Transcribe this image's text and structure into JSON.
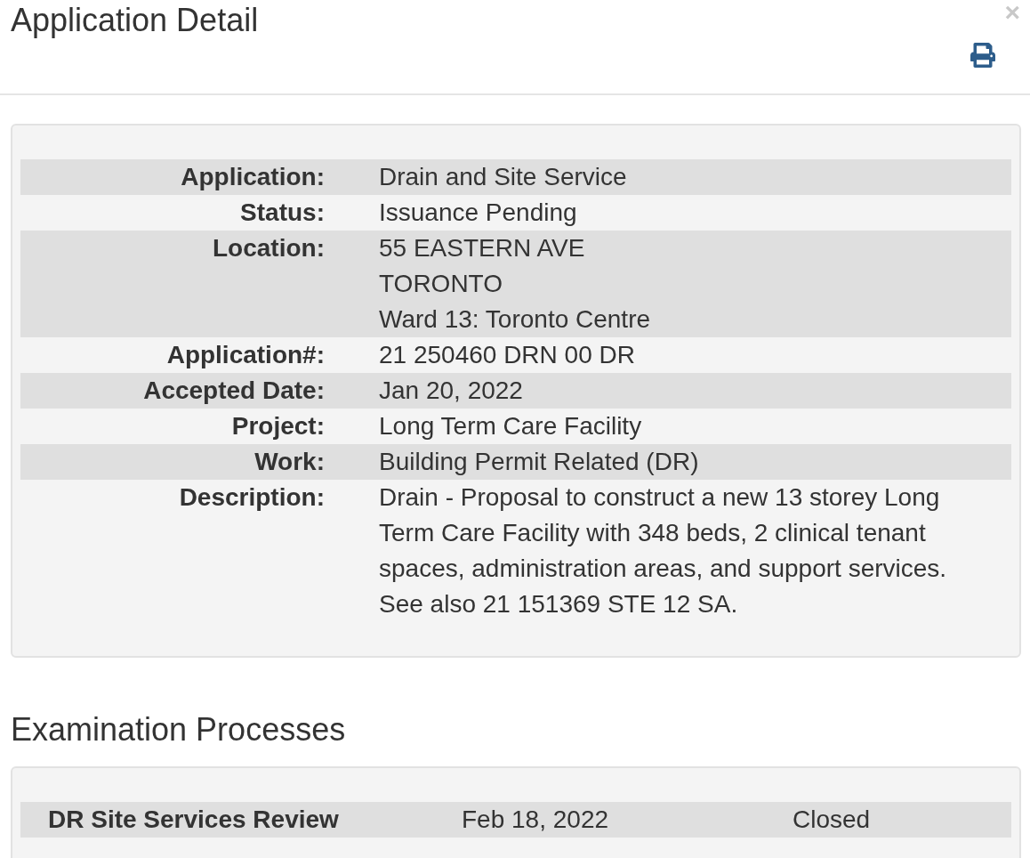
{
  "dialog": {
    "title": "Application Detail",
    "close": "×"
  },
  "details": [
    {
      "label": "Application:",
      "lines": [
        "Drain and Site Service"
      ]
    },
    {
      "label": "Status:",
      "lines": [
        "Issuance Pending"
      ]
    },
    {
      "label": "Location:",
      "lines": [
        "55 EASTERN AVE",
        "TORONTO",
        "Ward 13: Toronto Centre"
      ]
    },
    {
      "label": "Application#:",
      "lines": [
        "21 250460 DRN 00 DR"
      ]
    },
    {
      "label": "Accepted Date:",
      "lines": [
        "Jan 20, 2022"
      ]
    },
    {
      "label": "Project:",
      "lines": [
        "Long Term Care Facility"
      ]
    },
    {
      "label": "Work:",
      "lines": [
        "Building Permit Related (DR)"
      ]
    },
    {
      "label": "Description:",
      "lines": [
        "Drain - Proposal to construct a new 13 storey Long Term Care Facility with 348 beds, 2 clinical tenant spaces, administration areas, and support services. See also 21 151369 STE 12 SA."
      ]
    }
  ],
  "examination": {
    "heading": "Examination Processes",
    "rows": [
      {
        "process": "DR Site Services Review",
        "date": "Feb 18, 2022",
        "status": "Closed"
      }
    ]
  }
}
